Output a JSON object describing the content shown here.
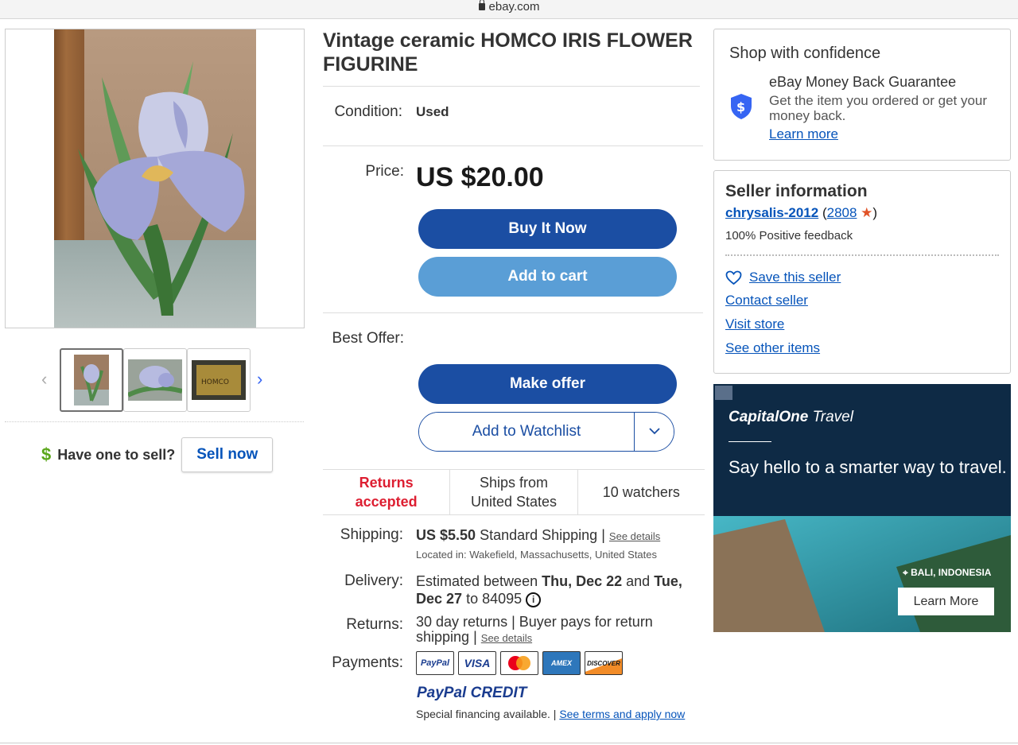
{
  "browser": {
    "url": "ebay.com"
  },
  "gallery": {
    "prev_arrow": "‹",
    "next_arrow": "›",
    "thumb3_text": "HOMCO"
  },
  "sell": {
    "prompt": "Have one to sell?",
    "button": "Sell now"
  },
  "item": {
    "title": "Vintage ceramic HOMCO IRIS FLOWER FIGURINE",
    "condition_label": "Condition:",
    "condition": "Used",
    "price_label": "Price:",
    "price": "US $20.00",
    "buy_now": "Buy It Now",
    "add_to_cart": "Add to cart",
    "best_offer_label": "Best Offer:",
    "make_offer": "Make offer",
    "add_to_watchlist": "Add to Watchlist"
  },
  "stats": {
    "returns": "Returns accepted",
    "ships_from": "Ships from United States",
    "watchers": "10 watchers"
  },
  "shipping": {
    "label": "Shipping:",
    "cost": "US $5.50",
    "service": "Standard Shipping",
    "sep": "|",
    "see_details": "See details",
    "location": "Located in: Wakefield, Massachusetts, United States"
  },
  "delivery": {
    "label": "Delivery:",
    "prefix": "Estimated between",
    "from": "Thu, Dec 22",
    "and": "and",
    "to_date": "Tue, Dec 27",
    "to_zip": "to 84095"
  },
  "returns": {
    "label": "Returns:",
    "text": "30 day returns | Buyer pays for return shipping",
    "sep": "|",
    "see_details": "See details"
  },
  "payments": {
    "label": "Payments:",
    "methods": [
      "PayPal",
      "VISA",
      "Mastercard",
      "AMEX",
      "DISCOVER"
    ],
    "paypal_credit": "PayPal CREDIT",
    "financing": "Special financing available.",
    "sep": "|",
    "terms_link": "See terms and apply now"
  },
  "confidence": {
    "heading": "Shop with confidence",
    "guarantee_title": "eBay Money Back Guarantee",
    "guarantee_text": "Get the item you ordered or get your money back.",
    "learn_more": "Learn more"
  },
  "seller": {
    "heading": "Seller information",
    "name": "chrysalis-2012",
    "open_paren": "(",
    "score": "2808",
    "close_paren": ")",
    "feedback": "100% Positive feedback",
    "save_seller": "Save this seller",
    "contact": "Contact seller",
    "visit_store": "Visit store",
    "other_items": "See other items"
  },
  "ad": {
    "brand": "CapitalOne",
    "brand_suffix": "Travel",
    "headline": "Say hello to a smarter way to travel.",
    "location": "BALI, INDONESIA",
    "cta": "Learn More"
  },
  "colors": {
    "primary_blue": "#1b4ea3",
    "light_blue": "#5a9ed6",
    "link_blue": "#0654ba",
    "returns_red": "#dd1e31"
  }
}
